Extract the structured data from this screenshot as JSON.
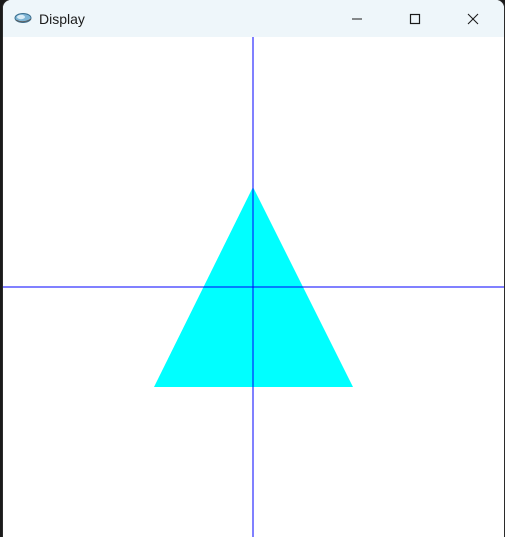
{
  "window": {
    "title": "Display"
  },
  "controls": {
    "minimize_icon": "minimize-icon",
    "maximize_icon": "maximize-icon",
    "close_icon": "close-icon"
  },
  "scene": {
    "background": "#ffffff",
    "axis_color": "#0000ff",
    "shape_color": "#00ffff",
    "shape": "triangle"
  }
}
